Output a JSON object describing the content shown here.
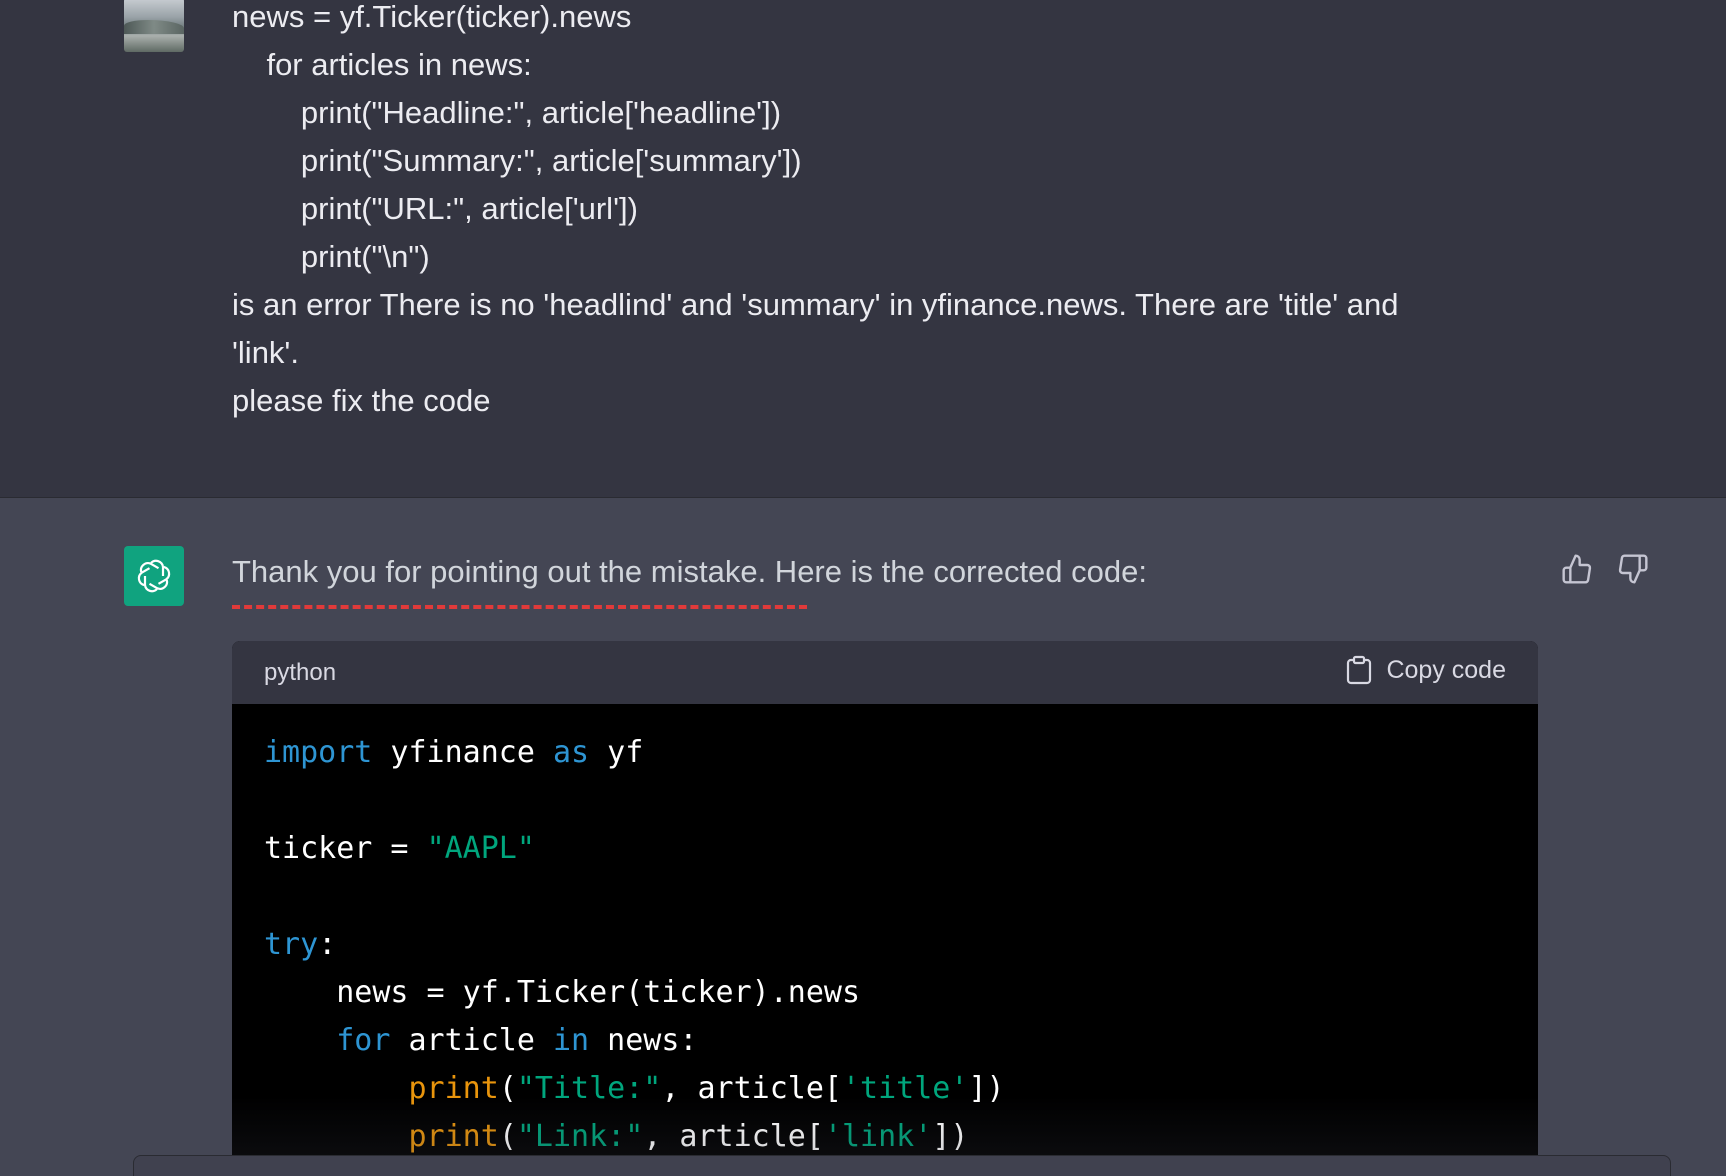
{
  "user_message": {
    "lines": [
      "news = yf.Ticker(ticker).news",
      "    for articles in news:",
      "        print(\"Headline:\", article['headline'])",
      "        print(\"Summary:\", article['summary'])",
      "        print(\"URL:\", article['url'])",
      "        print(\"\\n\")",
      "is an error There is no 'headlind' and 'summary' in yfinance.news. There are 'title' and",
      "'link'.",
      "please fix the code"
    ]
  },
  "assistant_message": {
    "intro": "Thank you for pointing out the mistake. Here is the corrected code:",
    "code_language": "python",
    "copy_label": "Copy code",
    "code_tokens": {
      "l1": [
        "import",
        " yfinance ",
        "as",
        " yf"
      ],
      "l2": [
        "ticker = ",
        "\"AAPL\""
      ],
      "l3": [
        "try",
        ":"
      ],
      "l4": [
        "    news = yf.Ticker(ticker).news"
      ],
      "l5": [
        "    ",
        "for",
        " article ",
        "in",
        " news:"
      ],
      "l6": [
        "        ",
        "print",
        "(",
        "\"Title:\"",
        ", article[",
        "'title'",
        "])"
      ],
      "l7": [
        "        ",
        "print",
        "(",
        "\"Link:\"",
        ", article[",
        "'link'",
        "])"
      ]
    }
  },
  "colors": {
    "page_bg": "#343541",
    "assistant_bg": "#444654",
    "brand": "#10a37f",
    "keyword": "#2e95d3",
    "string": "#00a67d",
    "builtin": "#e9950c",
    "annotation": "#e03a3a"
  },
  "icons": {
    "user_avatar": "user-avatar-photo",
    "assistant_avatar": "openai-logo-icon",
    "thumbs_up": "thumbs-up-icon",
    "thumbs_down": "thumbs-down-icon",
    "copy": "clipboard-icon"
  }
}
